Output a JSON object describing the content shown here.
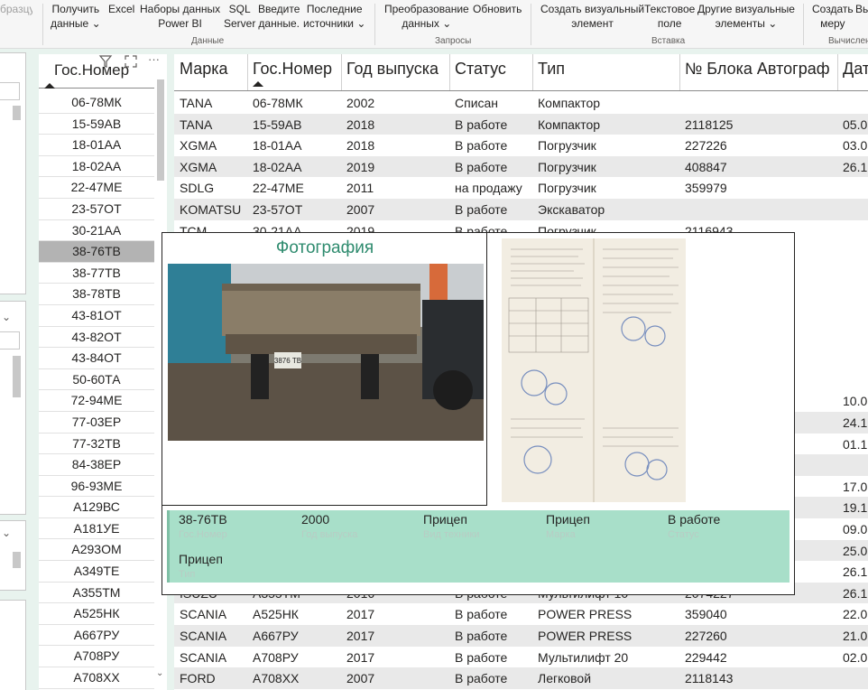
{
  "ribbon": {
    "left_cut": "бразцу",
    "get_data": [
      "Получить",
      "данные ⌄"
    ],
    "excel": "Excel",
    "powerbi_datasets": [
      "Наборы данных",
      "Power BI"
    ],
    "sql": [
      "SQL",
      "Server"
    ],
    "enter_data": [
      "Введите",
      "данные."
    ],
    "recent_sources": [
      "Последние",
      "источники ⌄"
    ],
    "transform": [
      "Преобразование",
      "данных ⌄"
    ],
    "refresh": "Обновить",
    "new_visual": [
      "Создать визуальный",
      "элемент"
    ],
    "text_box": [
      "Текстовое",
      "поле"
    ],
    "more_visuals": [
      "Другие визуальные",
      "элементы ⌄"
    ],
    "new_measure": [
      "Создать",
      "меру"
    ],
    "cut_right": "Вь",
    "groups": {
      "data": "Данные",
      "queries": "Запросы",
      "insert": "Вставка",
      "calc": "Вычислен"
    }
  },
  "slicer": {
    "header": "Гос.Номер",
    "items": [
      "06-78МК",
      "15-59АВ",
      "18-01АА",
      "18-02АА",
      "22-47МЕ",
      "23-57ОТ",
      "30-21АА",
      "38-76ТВ",
      "38-77ТВ",
      "38-78ТВ",
      "43-81ОТ",
      "43-82ОТ",
      "43-84ОТ",
      "50-60ТА",
      "72-94МЕ",
      "77-03ЕР",
      "77-32ТВ",
      "84-38ЕР",
      "96-93МЕ",
      "А129ВС",
      "А181УЕ",
      "А293ОМ",
      "А349ТЕ",
      "А355ТМ",
      "А525НК",
      "А667РУ",
      "А708РУ",
      "А708ХХ"
    ],
    "selected": "38-76ТВ",
    "icons": {
      "filter": "filter-icon",
      "focus": "focus-mode-icon",
      "more": "more-options-icon"
    }
  },
  "table": {
    "columns": [
      "Марка",
      "Гос.Номер",
      "Год выпуска",
      "Статус",
      "Тип",
      "№ Блока Автограф",
      "Дат"
    ],
    "rows_top": [
      [
        "TANA",
        "06-78МК",
        "2002",
        "Списан",
        "Компактор",
        "",
        ""
      ],
      [
        "TANA",
        "15-59АВ",
        "2018",
        "В работе",
        "Компактор",
        "2118125",
        "05.0"
      ],
      [
        "XGMA",
        "18-01АА",
        "2018",
        "В работе",
        "Погрузчик",
        "227226",
        "03.0"
      ],
      [
        "XGMA",
        "18-02АА",
        "2019",
        "В работе",
        "Погрузчик",
        "408847",
        "26.1"
      ],
      [
        "SDLG",
        "22-47МЕ",
        "2011",
        "на продажу",
        "Погрузчик",
        "359979",
        ""
      ],
      [
        "KOMATSU",
        "23-57ОТ",
        "2007",
        "В работе",
        "Экскаватор",
        "",
        ""
      ],
      [
        "TCM",
        "30-21АА",
        "2019",
        "В работе",
        "Погрузчик",
        "2116943",
        ""
      ]
    ],
    "right_peek": [
      "10.0",
      "24.1",
      "01.1",
      "",
      "17.0",
      "19.1",
      "09.0",
      "25.0",
      "26.1"
    ],
    "rows_bottom": [
      [
        "ISUZU",
        "А355ТМ",
        "2016",
        "В работе",
        "Мультилифт 10",
        "2074227",
        "26.1"
      ],
      [
        "SCANIA",
        "А525НК",
        "2017",
        "В работе",
        "POWER PRESS",
        "359040",
        "22.0"
      ],
      [
        "SCANIA",
        "А667РУ",
        "2017",
        "В работе",
        "POWER PRESS",
        "227260",
        "21.0"
      ],
      [
        "SCANIA",
        "А708РУ",
        "2017",
        "В работе",
        "Мультилифт 20",
        "229442",
        "02.0"
      ],
      [
        "FORD",
        "А708ХХ",
        "2007",
        "В работе",
        "Легковой",
        "2118143",
        ""
      ]
    ]
  },
  "card": {
    "photo_title": "Фотография",
    "plate_text": "3876 ТВ",
    "fields": [
      {
        "value": "38-76ТВ",
        "label": "Гос.Номер"
      },
      {
        "value": "2000",
        "label": "Год выпуска"
      },
      {
        "value": "Прицеп",
        "label": "Вид техники"
      },
      {
        "value": "Прицеп",
        "label": "Марка"
      },
      {
        "value": "В работе",
        "label": "Статус"
      },
      {
        "value": "Прицеп",
        "label": "Тип"
      }
    ]
  },
  "colors": {
    "accent_green": "#2e8b6e",
    "band": "#a8dfc9",
    "selected_row": "#b3b3b3",
    "canvas": "#e8f3ee"
  }
}
